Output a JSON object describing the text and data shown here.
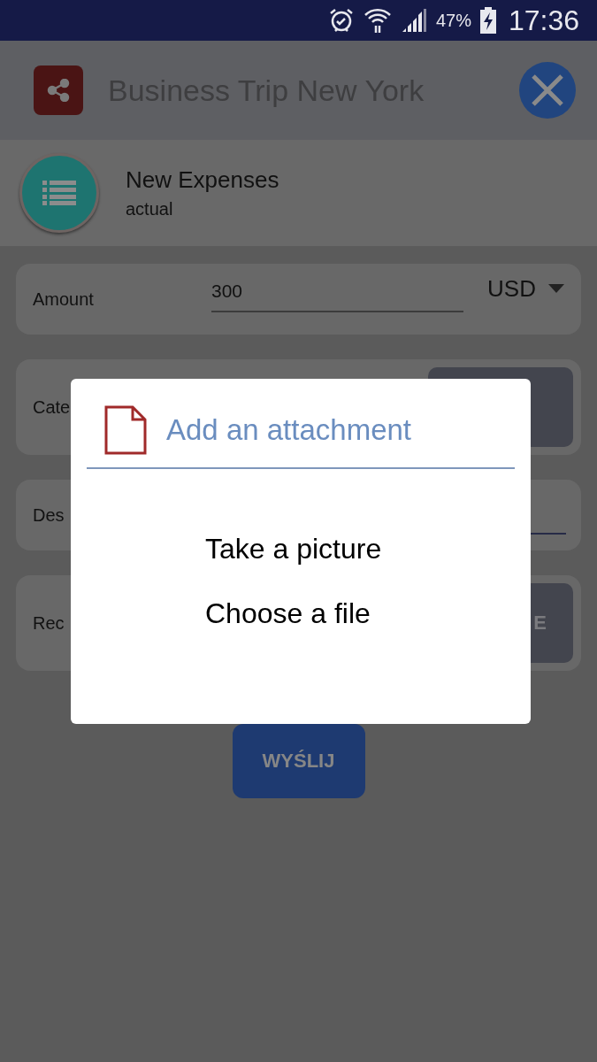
{
  "status_bar": {
    "battery": "47%",
    "time": "17:36"
  },
  "header": {
    "title": "Business Trip New York"
  },
  "subheader": {
    "title": "New Expenses",
    "subtitle": "actual"
  },
  "form": {
    "rows": [
      {
        "kind": "amount",
        "label": "Amount",
        "value": "300",
        "currency": "USD"
      },
      {
        "kind": "button",
        "label": "Cate"
      },
      {
        "kind": "field",
        "label": "Des"
      },
      {
        "kind": "button",
        "label": "Rec",
        "button": "E"
      }
    ]
  },
  "submit": "WYŚLIJ",
  "dialog": {
    "title": "Add an attachment",
    "options": [
      "Take a picture",
      "Choose a file"
    ]
  }
}
